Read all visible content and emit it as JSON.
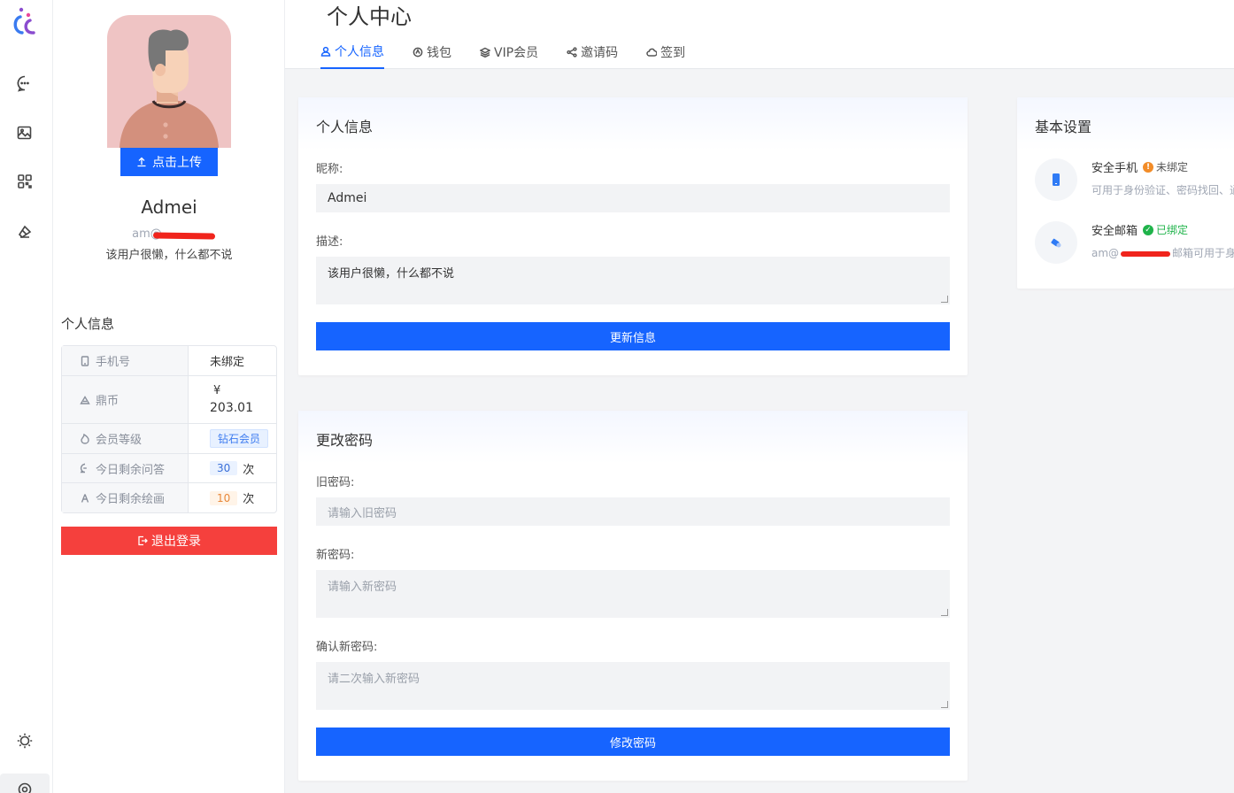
{
  "header": {
    "title": "个人中心",
    "tabs": [
      {
        "label": "个人信息",
        "icon": "user-icon",
        "active": true
      },
      {
        "label": "钱包",
        "icon": "wallet-icon",
        "active": false
      },
      {
        "label": "VIP会员",
        "icon": "layers-icon",
        "active": false
      },
      {
        "label": "邀请码",
        "icon": "share-icon",
        "active": false
      },
      {
        "label": "签到",
        "icon": "cloud-icon",
        "active": false
      }
    ]
  },
  "profile": {
    "upload_label": "点击上传",
    "name": "Admei",
    "email": "am@",
    "description": "该用户很懒，什么都不说",
    "section_title": "个人信息",
    "rows": [
      {
        "key": "手机号",
        "value": "未绑定"
      },
      {
        "key": "鼎币",
        "value_line1": "¥",
        "value_line2": "203.01"
      },
      {
        "key": "会员等级",
        "value": "钻石会员"
      },
      {
        "key": "今日剩余问答",
        "value": "30",
        "unit": "次"
      },
      {
        "key": "今日剩余绘画",
        "value": "10",
        "unit": "次"
      }
    ],
    "logout_label": "退出登录"
  },
  "info_form": {
    "title": "个人信息",
    "nickname_label": "昵称:",
    "nickname_value": "Admei",
    "desc_label": "描述:",
    "desc_value": "该用户很懒，什么都不说",
    "submit_label": "更新信息"
  },
  "password_form": {
    "title": "更改密码",
    "old_label": "旧密码:",
    "old_placeholder": "请输入旧密码",
    "new_label": "新密码:",
    "new_placeholder": "请输入新密码",
    "confirm_label": "确认新密码:",
    "confirm_placeholder": "请二次输入新密码",
    "submit_label": "修改密码"
  },
  "settings": {
    "title": "基本设置",
    "items": [
      {
        "title": "安全手机",
        "status": "未绑定",
        "status_color": "#f28c28",
        "desc": "可用于身份验证、密码找回、通"
      },
      {
        "title": "安全邮箱",
        "status": "已绑定",
        "status_color": "#1fb34a",
        "desc_prefix": "am@",
        "desc_suffix": "邮箱可用于身份"
      }
    ]
  },
  "colors": {
    "primary": "#1664ff",
    "danger": "#f5403d"
  }
}
